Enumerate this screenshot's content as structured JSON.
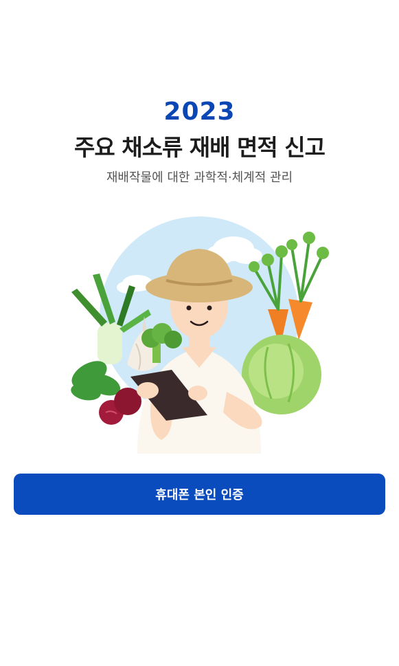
{
  "header": {
    "year": "2023",
    "title": "주요 채소류 재배 면적 신고",
    "subtitle": "재배작물에 대한 과학적·체계적 관리"
  },
  "illustration": {
    "icon": "farmer-with-tablet-and-vegetables",
    "colors": {
      "sky": "#cfe9f8",
      "hat": "#d8b67a",
      "skin": "#fbd9bf",
      "tablet": "#3b2a2c",
      "carrot": "#f07f24",
      "leaf": "#5aa83a",
      "cabbage": "#9fd46a",
      "beet": "#a31b3a"
    }
  },
  "actions": {
    "verify_label": "휴대폰 본인 인증"
  },
  "theme": {
    "accent": "#0a4bbd",
    "year_color": "#0a47b4",
    "text": "#1c1c1c",
    "muted": "#555555"
  }
}
